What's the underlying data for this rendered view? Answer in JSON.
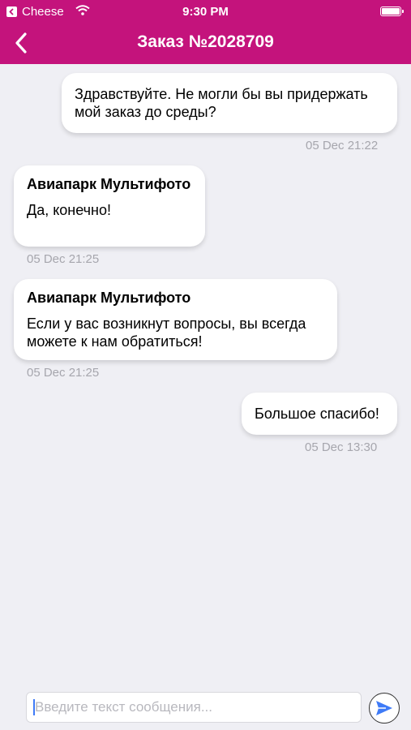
{
  "status_bar": {
    "carrier": "Cheese",
    "time": "9:30 PM"
  },
  "nav": {
    "title": "Заказ №2028709"
  },
  "messages": [
    {
      "direction": "outgoing",
      "sender": "",
      "text": "Здравствуйте. Не могли бы вы придержать мой заказ до среды?",
      "time": "05 Dec 21:22"
    },
    {
      "direction": "incoming",
      "sender": "Авиапарк Мультифото",
      "text": "Да, конечно!",
      "time": "05 Dec 21:25"
    },
    {
      "direction": "incoming",
      "sender": "Авиапарк Мультифото",
      "text": "Если у вас возникнут вопросы, вы всегда можете к нам обратиться!",
      "time": "05 Dec 21:25"
    },
    {
      "direction": "outgoing",
      "sender": "",
      "text": "Большое спасибо!",
      "time": "05 Dec 13:30"
    }
  ],
  "composer": {
    "placeholder": "Введите текст сообщения...",
    "value": ""
  },
  "icons": {
    "back": "chevron-left-icon",
    "send": "send-arrow-icon",
    "wifi": "wifi-icon",
    "battery": "battery-icon"
  },
  "colors": {
    "brand": "#c4137c",
    "background": "#efeff4",
    "bubble": "#ffffff",
    "timestamp": "#a6a6ad",
    "send_accent": "#3f7bf7"
  }
}
